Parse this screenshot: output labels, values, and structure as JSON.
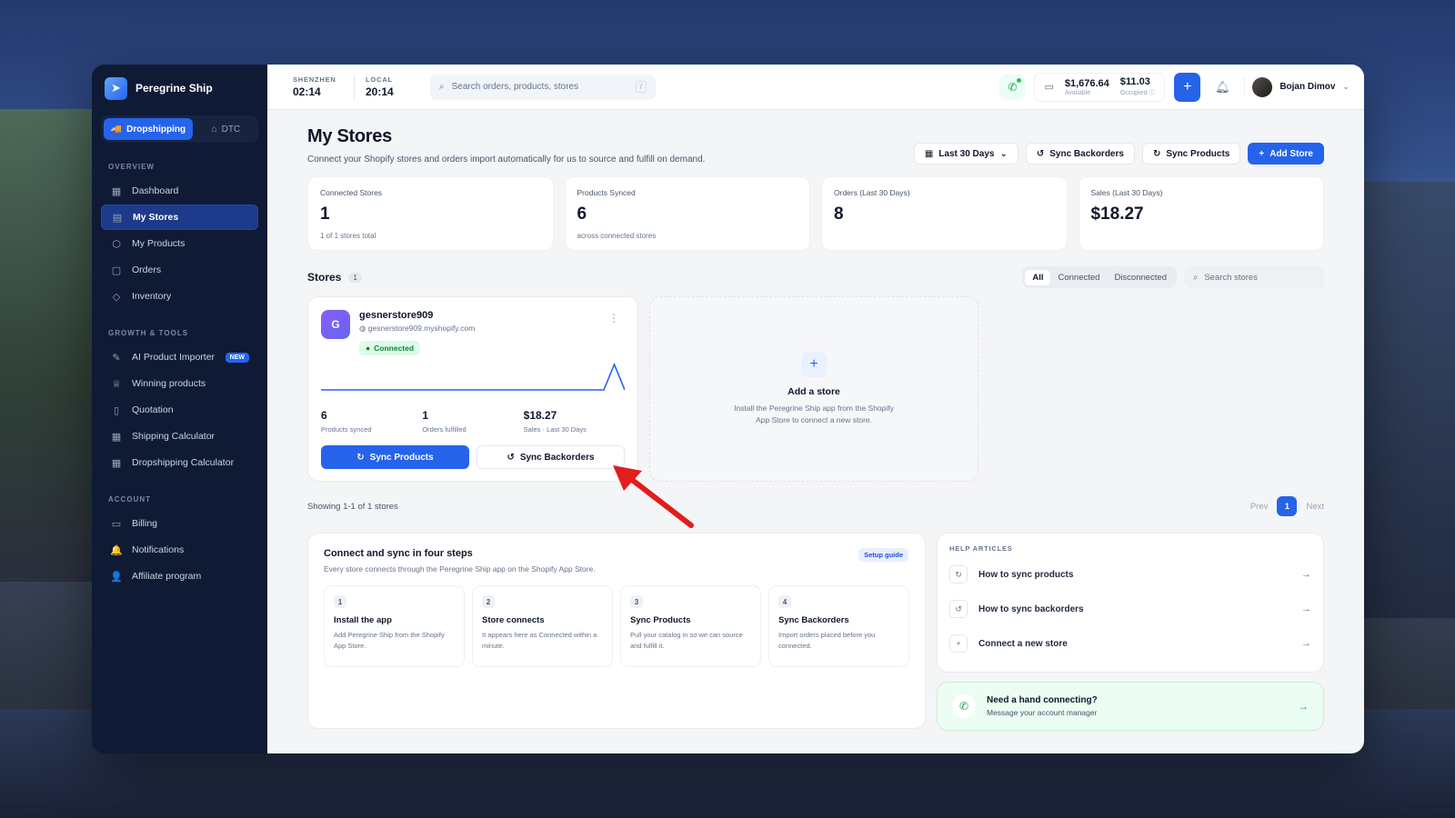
{
  "sidebar": {
    "brand": "Peregrine Ship",
    "modes": [
      {
        "label": "Dropshipping",
        "active": true
      },
      {
        "label": "DTC",
        "active": false
      }
    ],
    "sections": [
      {
        "title": "OVERVIEW",
        "items": [
          {
            "label": "Dashboard",
            "icon": "grid-icon"
          },
          {
            "label": "My Stores",
            "icon": "store-icon",
            "active": true
          },
          {
            "label": "My Products",
            "icon": "box-icon"
          },
          {
            "label": "Orders",
            "icon": "clipboard-icon"
          },
          {
            "label": "Inventory",
            "icon": "layers-icon"
          }
        ]
      },
      {
        "title": "GROWTH & TOOLS",
        "items": [
          {
            "label": "AI Product Importer",
            "icon": "wand-icon",
            "badge": "NEW"
          },
          {
            "label": "Winning products",
            "icon": "trophy-icon"
          },
          {
            "label": "Quotation",
            "icon": "document-icon"
          },
          {
            "label": "Shipping Calculator",
            "icon": "calculator-icon"
          },
          {
            "label": "Dropshipping Calculator",
            "icon": "calculator-icon"
          }
        ]
      },
      {
        "title": "ACCOUNT",
        "items": [
          {
            "label": "Billing",
            "icon": "card-icon"
          },
          {
            "label": "Notifications",
            "icon": "bell-icon"
          },
          {
            "label": "Affiliate program",
            "icon": "users-icon"
          }
        ]
      }
    ]
  },
  "topbar": {
    "clock1": {
      "city": "SHENZHEN",
      "time": "02:14"
    },
    "clock2": {
      "city": "LOCAL",
      "time": "20:14"
    },
    "search_placeholder": "Search orders, products, stores",
    "search_shortcut": "/",
    "available": {
      "value": "$1,676.64",
      "label": "Available"
    },
    "occupied": {
      "value": "$11.03",
      "label": "Occupied"
    },
    "user": "Bojan Dimov"
  },
  "page": {
    "title": "My Stores",
    "subtitle": "Connect your Shopify stores and orders import automatically for us to source and fulfill on demand.",
    "actions": {
      "range": "Last 30 Days",
      "sync_backorders": "Sync Backorders",
      "sync_products": "Sync Products",
      "add_store": "Add Store"
    }
  },
  "stats": [
    {
      "label": "Connected Stores",
      "value": "1",
      "sub": "1 of 1 stores total"
    },
    {
      "label": "Products Synced",
      "value": "6",
      "sub": "across connected stores"
    },
    {
      "label": "Orders (Last 30 Days)",
      "value": "8",
      "sub": ""
    },
    {
      "label": "Sales (Last 30 Days)",
      "value": "$18.27",
      "sub": ""
    }
  ],
  "stores": {
    "title": "Stores",
    "count": "1",
    "filters": [
      "All",
      "Connected",
      "Disconnected"
    ],
    "active_filter": "All",
    "search_placeholder": "Search stores",
    "card": {
      "initial": "G",
      "name": "gesnerstore909",
      "url": "gesnerstore909.myshopify.com",
      "status": "Connected",
      "sparkline": [
        0,
        0,
        0,
        0,
        0,
        0,
        0,
        0,
        0,
        0,
        0,
        0,
        0,
        0,
        0,
        0,
        0,
        0,
        0,
        0,
        0,
        0,
        0,
        0,
        0,
        0,
        0,
        0,
        8,
        0
      ],
      "stats": [
        {
          "value": "6",
          "label": "Products synced"
        },
        {
          "value": "1",
          "label": "Orders fulfilled"
        },
        {
          "value": "$18.27",
          "label": "Sales · Last 30 Days"
        }
      ],
      "sync_products": "Sync Products",
      "sync_backorders": "Sync Backorders"
    },
    "add": {
      "title": "Add a store",
      "desc": "Install the Peregrine Ship app from the Shopify App Store to connect a new store."
    },
    "showing": "Showing 1-1 of 1 stores",
    "pager": {
      "prev": "Prev",
      "page": "1",
      "next": "Next"
    }
  },
  "steps": {
    "title": "Connect and sync in four steps",
    "subtitle": "Every store connects through the Peregrine Ship app on the Shopify App Store.",
    "badge": "Setup guide",
    "items": [
      {
        "n": "1",
        "title": "Install the app",
        "desc": "Add Peregrine Ship from the Shopify App Store."
      },
      {
        "n": "2",
        "title": "Store connects",
        "desc": "It appears here as Connected within a minute."
      },
      {
        "n": "3",
        "title": "Sync Products",
        "desc": "Pull your catalog in so we can source and fulfill it."
      },
      {
        "n": "4",
        "title": "Sync Backorders",
        "desc": "Import orders placed before you connected."
      }
    ]
  },
  "help": {
    "label": "HELP ARTICLES",
    "items": [
      {
        "text": "How to sync products",
        "icon": "refresh-icon"
      },
      {
        "text": "How to sync backorders",
        "icon": "history-icon"
      },
      {
        "text": "Connect a new store",
        "icon": "plus-icon"
      }
    ]
  },
  "support": {
    "title": "Need a hand connecting?",
    "subtitle": "Message your account manager"
  },
  "colors": {
    "accent": "#2563eb",
    "sidebar": "#0f1a35",
    "success": "#16a34a"
  }
}
